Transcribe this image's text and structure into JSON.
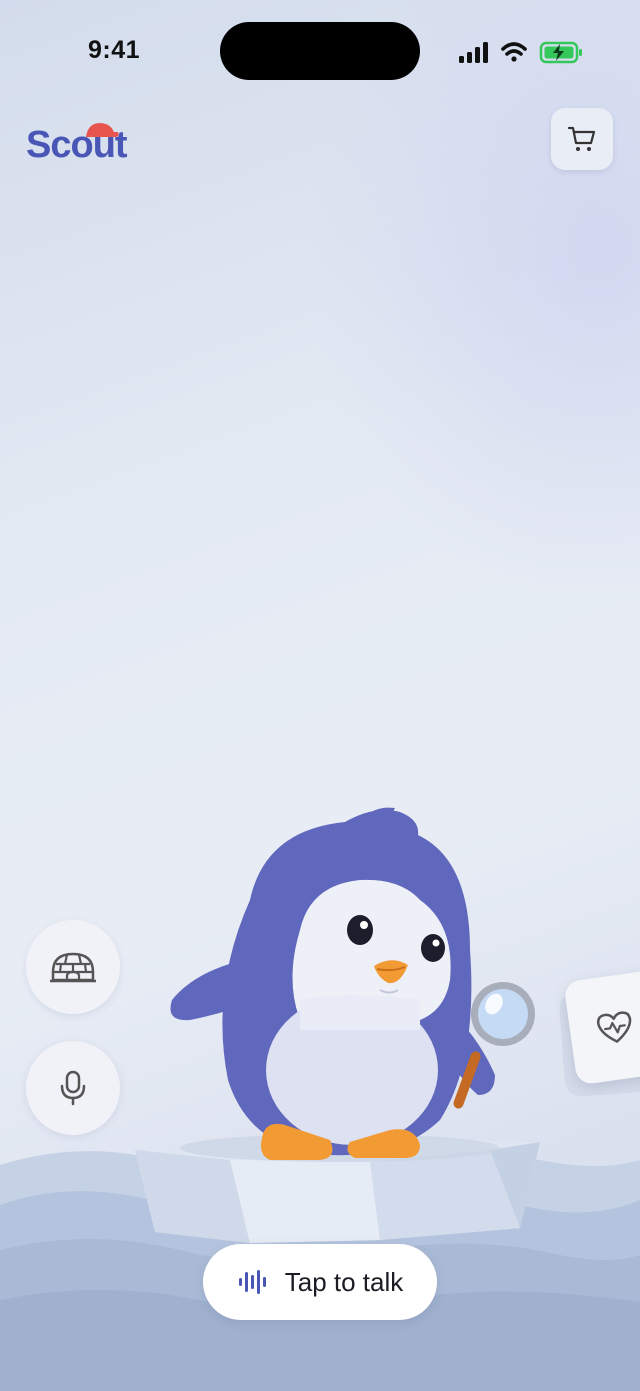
{
  "status_bar": {
    "time": "9:41"
  },
  "header": {
    "logo_text": "Scout",
    "cart_icon": "cart-icon"
  },
  "side_actions": [
    {
      "icon": "igloo-icon"
    },
    {
      "icon": "microphone-icon"
    }
  ],
  "health_card": {
    "icon": "heart-pulse-icon"
  },
  "talk_button": {
    "label": "Tap to talk",
    "icon": "voice-wave-icon"
  },
  "colors": {
    "brand": "#4956b5",
    "penguin_body": "#5f68bd",
    "penguin_belly": "#e9ebf6",
    "penguin_feet": "#f29a34",
    "logo_hat": "#e8554e",
    "battery": "#34c759"
  }
}
